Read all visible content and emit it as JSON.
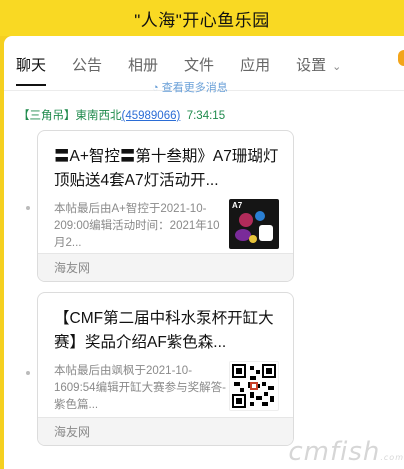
{
  "window": {
    "title": "\"人海\"开心鱼乐园"
  },
  "tabs": [
    {
      "label": "聊天",
      "active": true
    },
    {
      "label": "公告"
    },
    {
      "label": "相册"
    },
    {
      "label": "文件"
    },
    {
      "label": "应用"
    },
    {
      "label": "设置"
    }
  ],
  "history_link": "查看更多消息",
  "message": {
    "sender_tag": "【三角吊】",
    "sender_name": "東南西北",
    "sender_id": "(45989066)",
    "time": "7:34:15"
  },
  "cards": [
    {
      "title": "〓A+智控〓第十叁期》A7珊瑚灯顶贴送4套A7灯活动开...",
      "desc": "本帖最后由A+智控于2021-10-209:00编辑活动时间：2021年10月2...",
      "thumb_label": "A7",
      "source": "海友网"
    },
    {
      "title": "【CMF第二届中科水泵杯开缸大赛】奖品介绍AF紫色森...",
      "desc": "本帖最后由飒枫于2021-10-1609:54编辑开缸大赛参与奖解答-紫色篇...",
      "source": "海友网"
    }
  ],
  "watermark": {
    "text": "cmfish",
    "suffix": ".com"
  },
  "colors": {
    "accent_yellow": "#f9d923",
    "sender_green": "#1f8a4c",
    "link_blue": "#2b6dd6"
  }
}
